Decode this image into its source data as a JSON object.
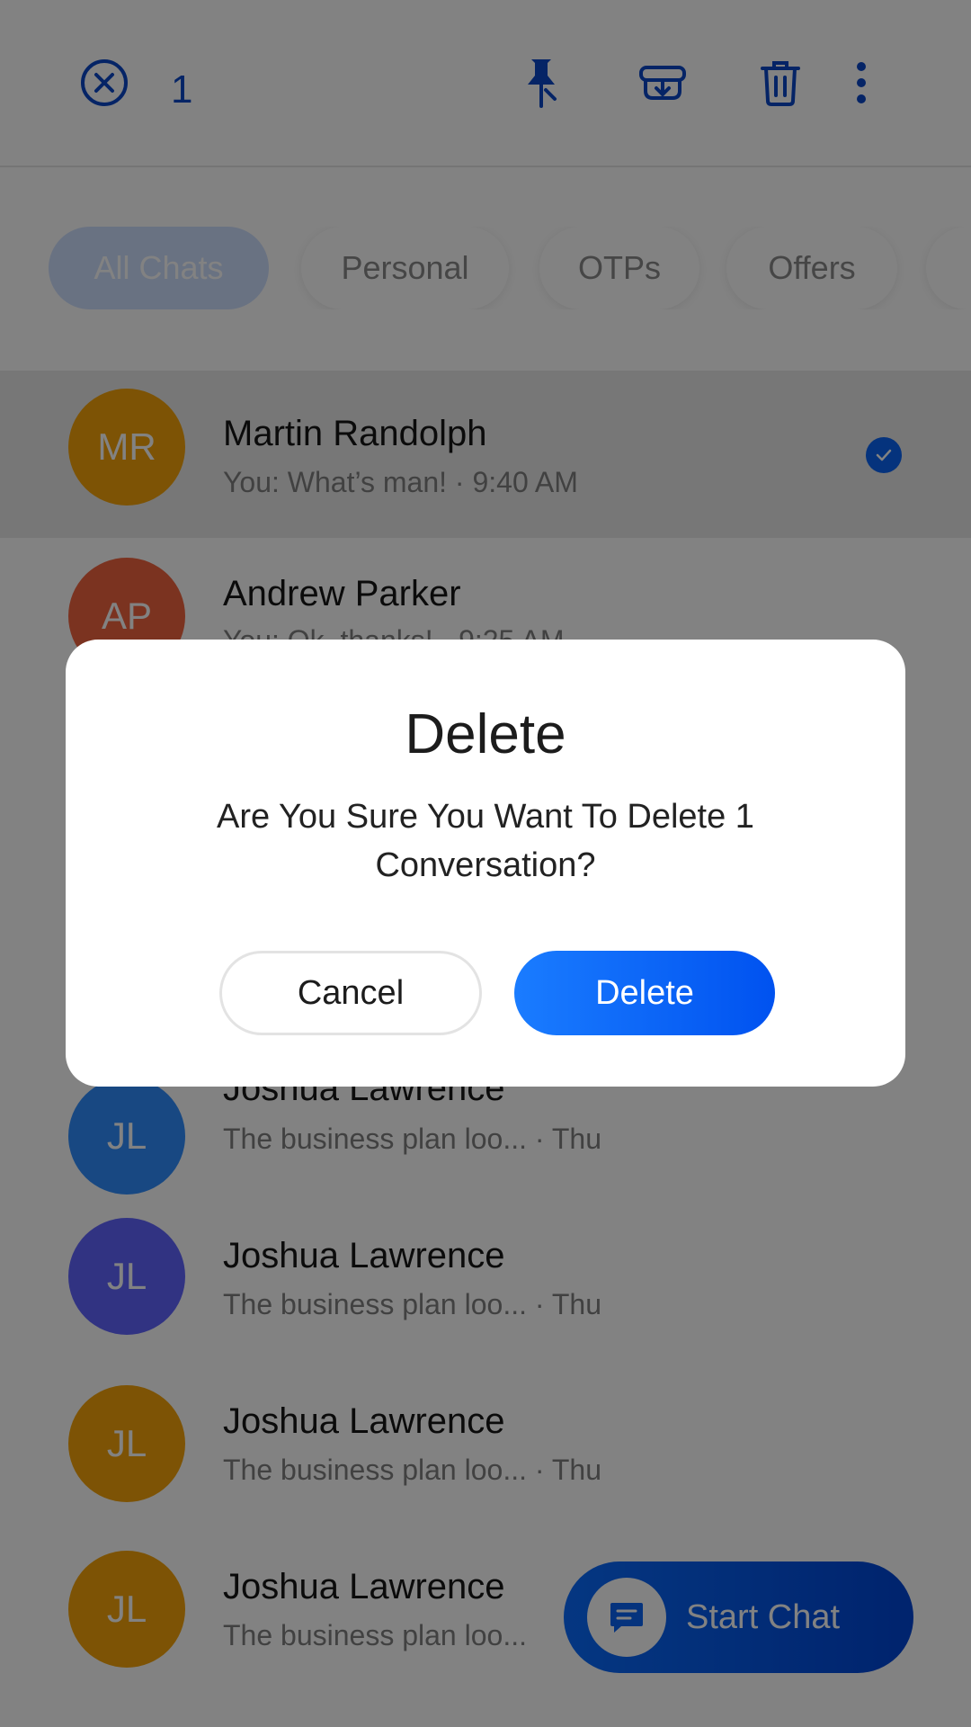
{
  "selection_bar": {
    "count": "1",
    "icons": [
      "close-circle-icon",
      "pin-icon",
      "archive-icon",
      "trash-icon",
      "more-vertical-icon"
    ]
  },
  "filters": [
    {
      "label": "All Chats",
      "active": true
    },
    {
      "label": "Personal",
      "active": false
    },
    {
      "label": "OTPs",
      "active": false
    },
    {
      "label": "Offers",
      "active": false
    }
  ],
  "conversations": [
    {
      "initials": "MR",
      "name": "Martin Randolph",
      "preview": "You: What’s man! · 9:40 AM",
      "color": "#f5a40a",
      "selected": true
    },
    {
      "initials": "AP",
      "name": "Andrew Parker",
      "preview": "You: Ok, thanks! · 9:25 AM",
      "color": "#f26440",
      "selected": false
    },
    {
      "initials": "JL",
      "name": "Joshua Lawrence",
      "preview": "The business plan loo...  · Thu",
      "color": "#2f8eff",
      "selected": false
    },
    {
      "initials": "JL",
      "name": "Joshua Lawrence",
      "preview": "The business plan loo...  · Thu",
      "color": "#6165ff",
      "selected": false
    },
    {
      "initials": "JL",
      "name": "Joshua Lawrence",
      "preview": "The business plan loo...  · Thu",
      "color": "#f5a40a",
      "selected": false
    },
    {
      "initials": "JL",
      "name": "Joshua Lawrence",
      "preview": "The business plan loo...",
      "color": "#f5a40a",
      "selected": false
    }
  ],
  "fab": {
    "label": "Start Chat",
    "icon": "message-icon"
  },
  "dialog": {
    "title": "Delete",
    "message": "Are You Sure You Want To Delete 1 Conversation?",
    "cancel_label": "Cancel",
    "delete_label": "Delete"
  },
  "colors": {
    "accent": "#0a64f5",
    "icon": "#0a47c9"
  }
}
